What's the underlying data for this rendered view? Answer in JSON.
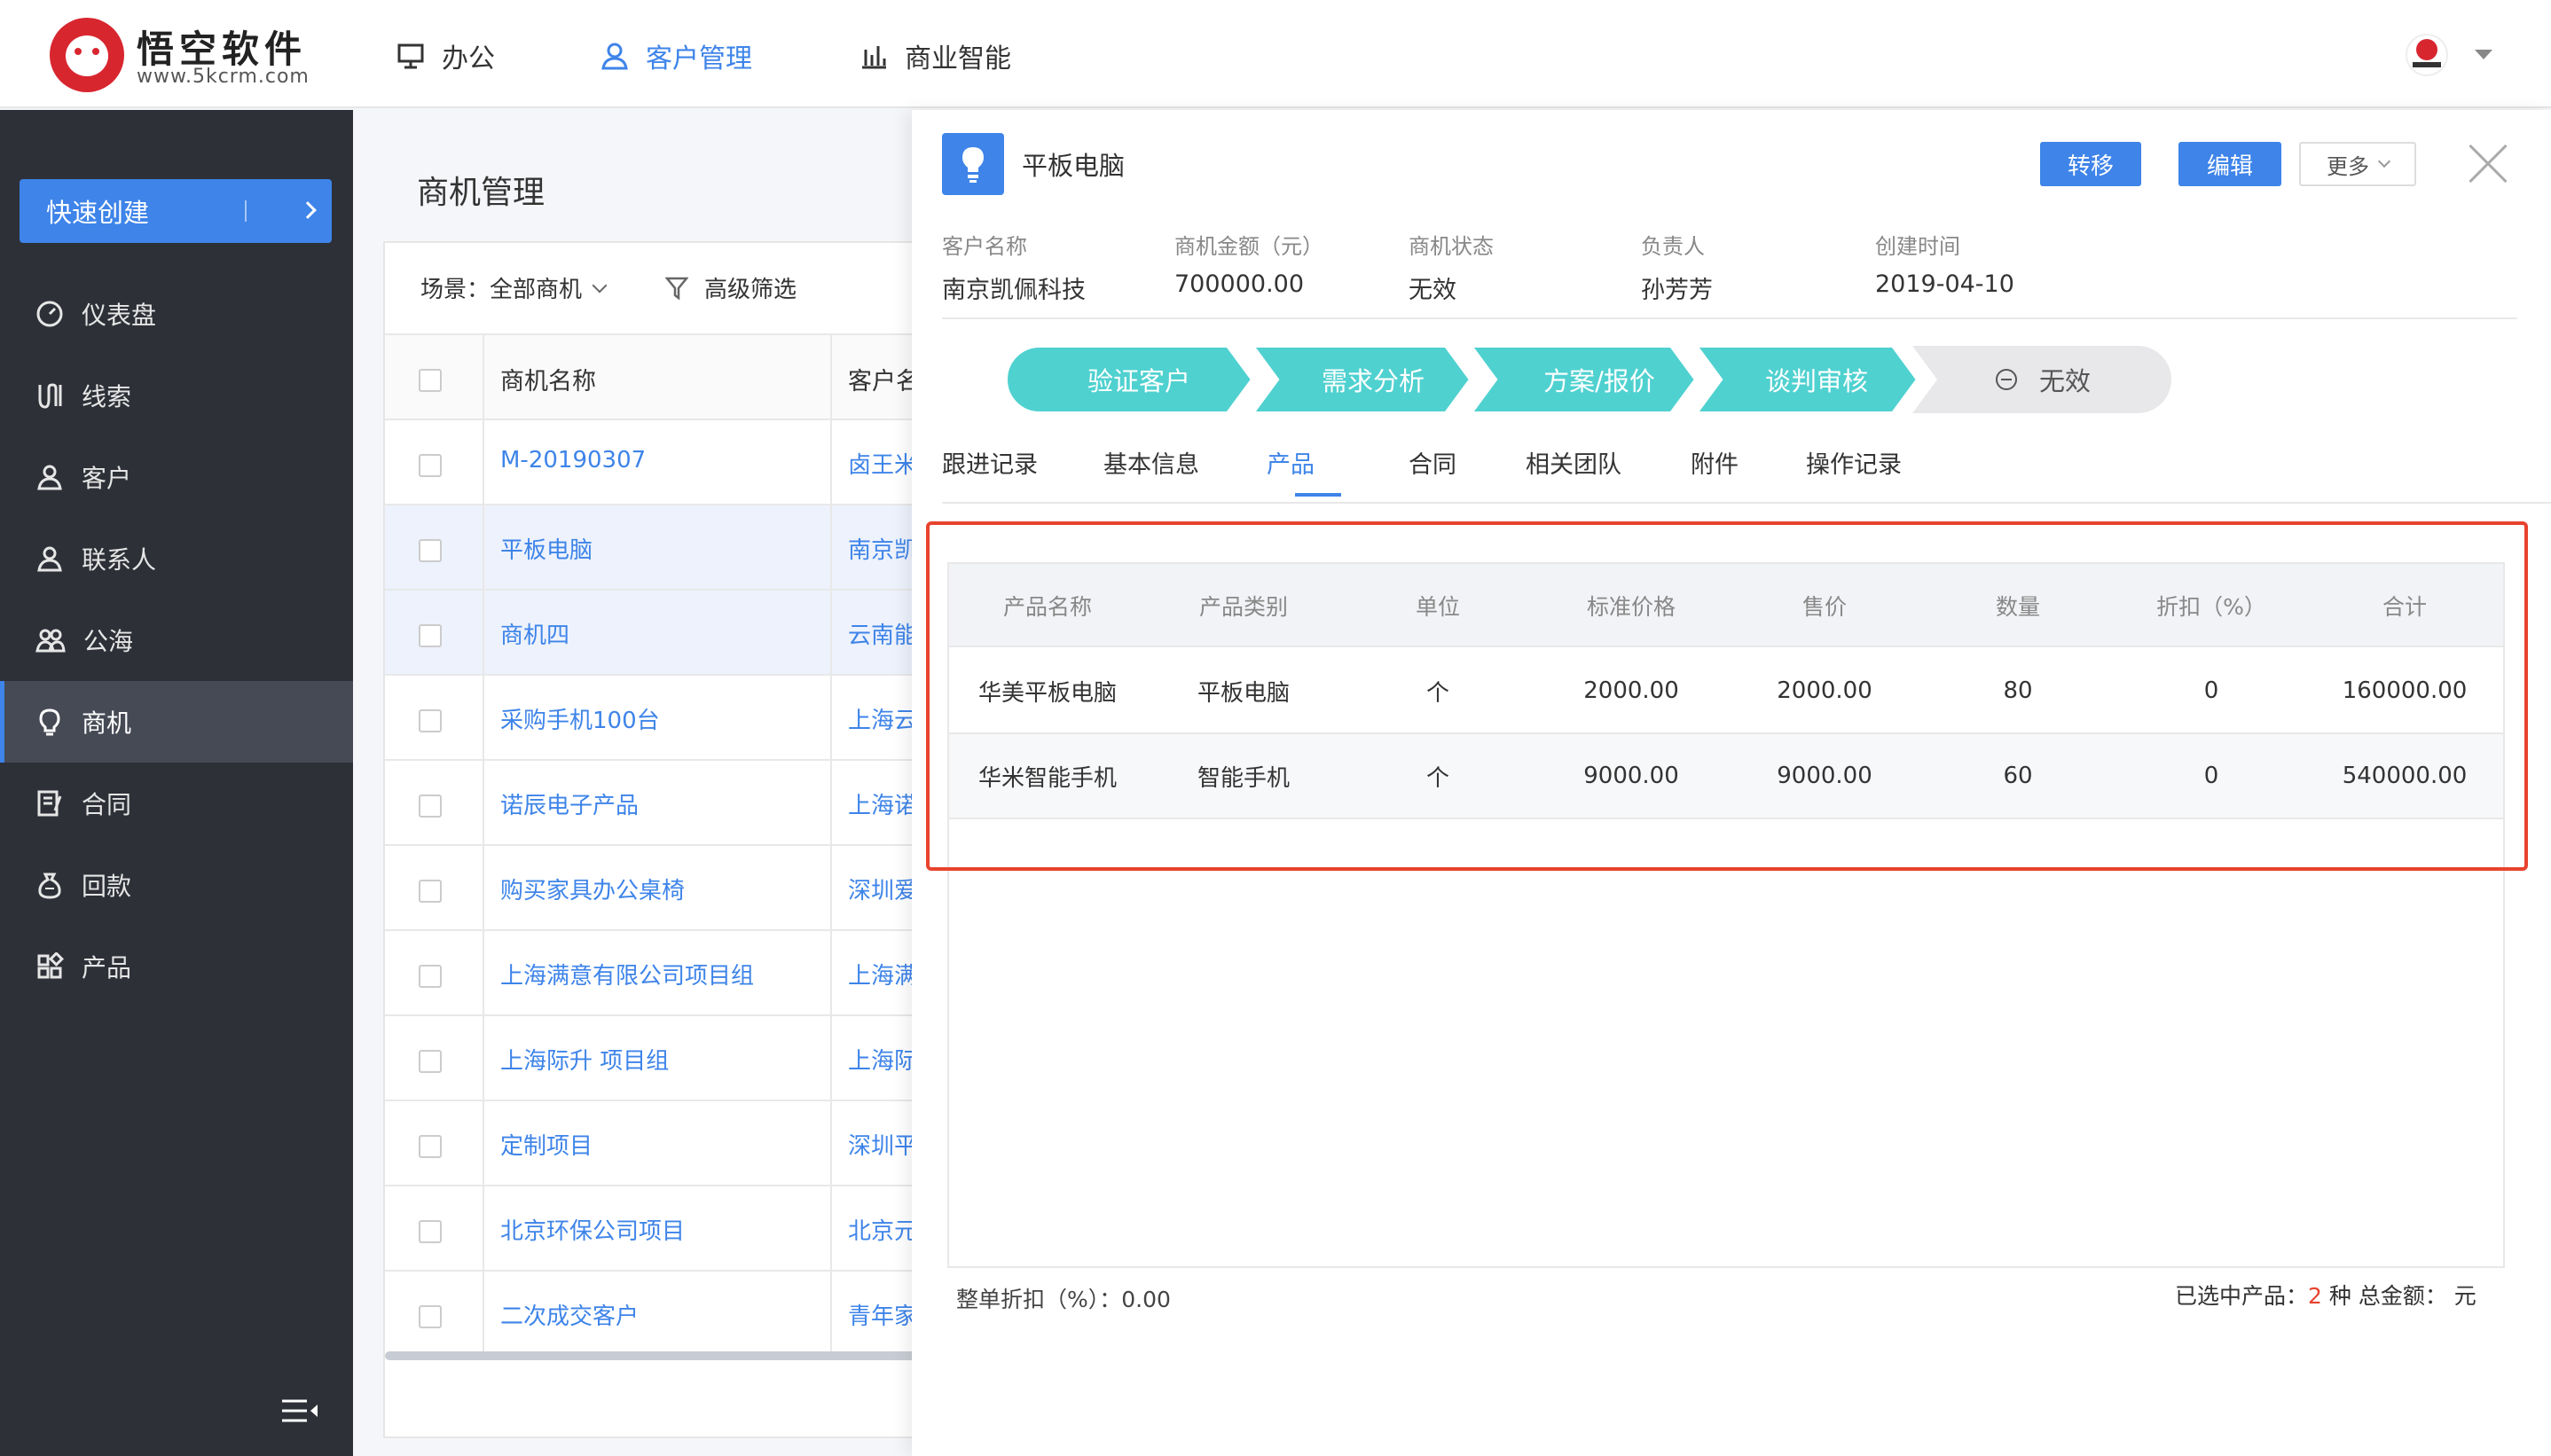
{
  "brand": {
    "name": "悟空软件",
    "url": "www.5kcrm.com"
  },
  "topnav": {
    "items": [
      {
        "label": "办公",
        "icon": "monitor-icon"
      },
      {
        "label": "客户管理",
        "icon": "user-icon"
      },
      {
        "label": "商业智能",
        "icon": "bar-chart-icon"
      }
    ],
    "active": "客户管理",
    "active_color": "#3e84e9"
  },
  "sidebar": {
    "quick_create": "快速创建",
    "items": [
      {
        "label": "仪表盘",
        "icon": "dashboard-icon"
      },
      {
        "label": "线索",
        "icon": "magnet-icon"
      },
      {
        "label": "客户",
        "icon": "user-icon"
      },
      {
        "label": "联系人",
        "icon": "contact-icon"
      },
      {
        "label": "公海",
        "icon": "group-icon"
      },
      {
        "label": "商机",
        "icon": "lightbulb-icon"
      },
      {
        "label": "合同",
        "icon": "contract-icon"
      },
      {
        "label": "回款",
        "icon": "money-bag-icon"
      },
      {
        "label": "产品",
        "icon": "grid-icon"
      }
    ],
    "active": "商机"
  },
  "list": {
    "title": "商机管理",
    "scene_label": "场景：全部商机",
    "filter_label": "高级筛选",
    "columns": [
      "商机名称",
      "客户名"
    ],
    "rows": [
      {
        "name": "M-20190307",
        "customer": "卤王米"
      },
      {
        "name": "平板电脑",
        "customer": "南京凯"
      },
      {
        "name": "商机四",
        "customer": "云南能"
      },
      {
        "name": "采购手机100台",
        "customer": "上海云"
      },
      {
        "name": "诺辰电子产品",
        "customer": "上海诺"
      },
      {
        "name": "购买家具办公桌椅",
        "customer": "深圳爱"
      },
      {
        "name": "上海满意有限公司项目组",
        "customer": "上海满"
      },
      {
        "name": "上海际升 项目组",
        "customer": "上海际"
      },
      {
        "name": "定制项目",
        "customer": "深圳平"
      },
      {
        "name": "北京环保公司项目",
        "customer": "北京元"
      },
      {
        "name": "二次成交客户",
        "customer": "青年家"
      }
    ]
  },
  "detail": {
    "title": "平板电脑",
    "buttons": {
      "transfer": "转移",
      "edit": "编辑",
      "more": "更多"
    },
    "info": [
      {
        "label": "客户名称",
        "value": "南京凯佩科技"
      },
      {
        "label": "商机金额（元）",
        "value": "700000.00"
      },
      {
        "label": "商机状态",
        "value": "无效"
      },
      {
        "label": "负责人",
        "value": "孙芳芳"
      },
      {
        "label": "创建时间",
        "value": "2019-04-10"
      }
    ],
    "stages": [
      "验证客户",
      "需求分析",
      "方案/报价",
      "谈判审核",
      "无效"
    ],
    "stage_color": "#4fd1d0",
    "tabs": [
      "跟进记录",
      "基本信息",
      "产品",
      "合同",
      "相关团队",
      "附件",
      "操作记录"
    ],
    "active_tab": "产品",
    "products": {
      "columns": [
        "产品名称",
        "产品类别",
        "单位",
        "标准价格",
        "售价",
        "数量",
        "折扣（%）",
        "合计"
      ],
      "rows": [
        [
          "华美平板电脑",
          "平板电脑",
          "个",
          "2000.00",
          "2000.00",
          "80",
          "0",
          "160000.00"
        ],
        [
          "华米智能手机",
          "智能手机",
          "个",
          "9000.00",
          "9000.00",
          "60",
          "0",
          "540000.00"
        ]
      ]
    },
    "footer": {
      "discount_label": "整单折扣（%）：",
      "discount_value": "0.00",
      "selected_prefix": "已选中产品：",
      "selected_count": "2",
      "selected_suffix": " 种  总金额：  元"
    },
    "highlight_color": "#e8432e"
  }
}
